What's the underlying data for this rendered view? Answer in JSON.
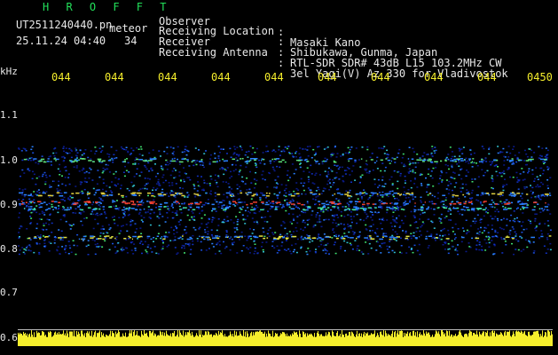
{
  "header": {
    "title": "H R O F F T",
    "filename": "UT2511240440.pn",
    "meteor_label": "meteor",
    "datetime": "25.11.24 04:40",
    "count": "34"
  },
  "info": [
    {
      "label": "Observer",
      "sep": ":",
      "value": "Masaki Kano"
    },
    {
      "label": "Receiving Location",
      "sep": ":",
      "value": "Shibukawa, Gunma, Japan"
    },
    {
      "label": "Receiver",
      "sep": ":",
      "value": "RTL-SDR SDR# 43dB L15 103.2MHz CW"
    },
    {
      "label": "Receiving Antenna",
      "sep": ":",
      "value": "3el Yagi(V) Az 330 for Vladivostok"
    }
  ],
  "axis": {
    "unit": "kHz",
    "y_ticks": [
      "1.1",
      "1.0",
      "0.9",
      "0.8",
      "0.7",
      "0.6"
    ],
    "x_ticks": [
      "044",
      "044",
      "044",
      "044",
      "044",
      "044",
      "044",
      "044",
      "044",
      "0450"
    ]
  },
  "colors": {
    "label": "#e8e8e8",
    "title": "#22e05a",
    "time_ticks": "#f5ee2c",
    "background": "#000000"
  }
}
